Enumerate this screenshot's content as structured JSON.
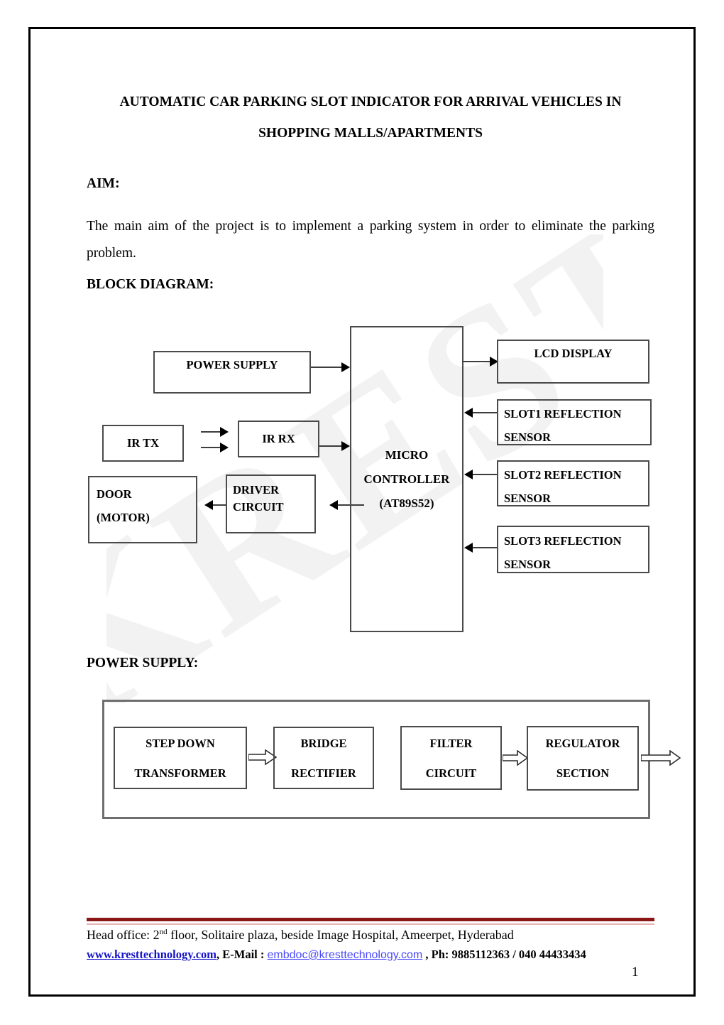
{
  "document": {
    "title": "AUTOMATIC CAR PARKING SLOT INDICATOR FOR ARRIVAL VEHICLES IN SHOPPING MALLS/APARTMENTS",
    "page_number": "1"
  },
  "sections": {
    "aim_heading": "AIM:",
    "aim_body": "The main aim of the project is to implement a parking system in order to eliminate the parking problem.",
    "block_diagram_heading": "BLOCK DIAGRAM:",
    "power_supply_heading": "POWER SUPPLY:"
  },
  "watermark": {
    "text": "KREST"
  },
  "block_diagram": {
    "boxes": {
      "power_supply": "POWER SUPPLY",
      "ir_tx": "IR TX",
      "ir_rx": "IR RX",
      "door_motor": "DOOR\n(MOTOR)",
      "driver_circuit": "DRIVER\nCIRCUIT",
      "microcontroller": "MICRO\nCONTROLLER\n(AT89S52)",
      "lcd_display": "LCD DISPLAY",
      "slot1_sensor": "SLOT1 REFLECTION\nSENSOR",
      "slot2_sensor": "SLOT2 REFLECTION\nSENSOR",
      "slot3_sensor": "SLOT3 REFLECTION\nSENSOR"
    }
  },
  "power_supply_diagram": {
    "boxes": {
      "step_down_transformer": "STEP DOWN\n\nTRANSFORMER",
      "bridge_rectifier": "BRIDGE\n\nRECTIFIER",
      "filter_circuit": "FILTER\n\nCIRCUIT",
      "regulator_section": "REGULATOR\n\nSECTION"
    }
  },
  "footer": {
    "address": "Head office: 2",
    "address_sup": "nd",
    "address_rest": " floor, Solitaire plaza, beside Image Hospital, Ameerpet, Hyderabad",
    "website": "www.kresttechnology.com",
    "separator1": ", E-Mail : ",
    "email": "embdoc@kresttechnology.com",
    "phone": " , Ph: 9885112363 / 040 44433434",
    "rule_color": "#8c1515"
  }
}
